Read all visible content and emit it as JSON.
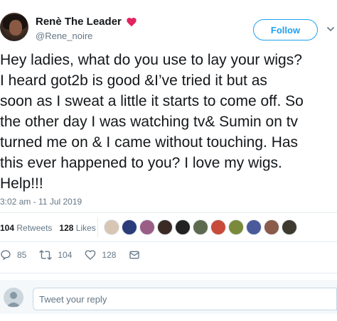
{
  "user": {
    "display_name": "Renè The Leader",
    "handle": "@Rene_noire"
  },
  "follow_label": "Follow",
  "tweet": {
    "text": "Hey ladies, what do you use to lay your wigs?\nI heard got2b is good &I’ve tried it but as\nsoon as I sweat a little it starts to come off. So\nthe other day I was watching tv& Sumin on tv\nturned me on & I came without touching. Has\nthis ever happened to you? I love my wigs.\nHelp!!!",
    "timestamp": "3:02 am - 11 Jul 2019"
  },
  "stats": {
    "retweets_count": "104",
    "retweets_label": "Retweets",
    "likes_count": "128",
    "likes_label": "Likes"
  },
  "actions": {
    "replies": "85",
    "retweets": "104",
    "likes": "128"
  },
  "reply": {
    "placeholder": "Tweet your reply"
  },
  "colors": {
    "accent": "#1da1f2",
    "heart": "#e0245e",
    "muted": "#657786"
  },
  "icons": [
    "heart-emoji-icon",
    "chevron-down-icon",
    "reply-icon",
    "retweet-icon",
    "like-icon",
    "direct-message-icon"
  ]
}
